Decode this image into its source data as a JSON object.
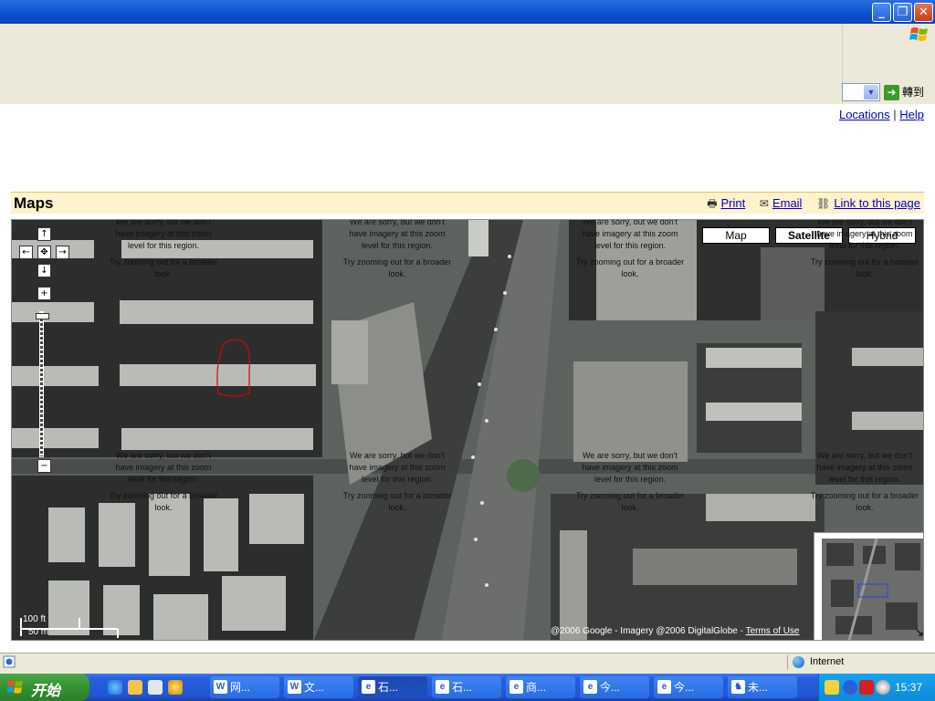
{
  "window": {
    "title": "",
    "controls": {
      "minimize": "_",
      "maximize": "❐",
      "close": "✕"
    }
  },
  "toolbar": {
    "go_label": "轉到"
  },
  "page": {
    "top_links": [
      "Locations",
      "Help"
    ],
    "maps_title": "Maps",
    "actions": {
      "print": "Print",
      "email": "Email",
      "link": "Link to this page"
    }
  },
  "map": {
    "types": {
      "map": "Map",
      "satellite": "Satellite",
      "hybrid": "Hybrid"
    },
    "sorry": {
      "line1": "We are sorry, but we don't have imagery at this zoom level for this region.",
      "line2": "Try zooming out for a broader look."
    },
    "scale": {
      "feet": "100 ft",
      "meters": "50 m"
    },
    "copyright": "@2006 Google - Imagery @2006 DigitalGlobe - ",
    "terms": "Terms of Use"
  },
  "status": {
    "zone": "Internet"
  },
  "taskbar": {
    "start": "开始",
    "tasks": [
      "网...",
      "文...",
      "石...",
      "石...",
      "商...",
      "今...",
      "今...",
      "未..."
    ],
    "clock": "15:37"
  },
  "colors": {
    "title_bar": "#0a4fcf",
    "maps_bar": "#fff3cc",
    "link": "#0000cc",
    "taskbar": "#245edb",
    "start_button": "#379532"
  }
}
